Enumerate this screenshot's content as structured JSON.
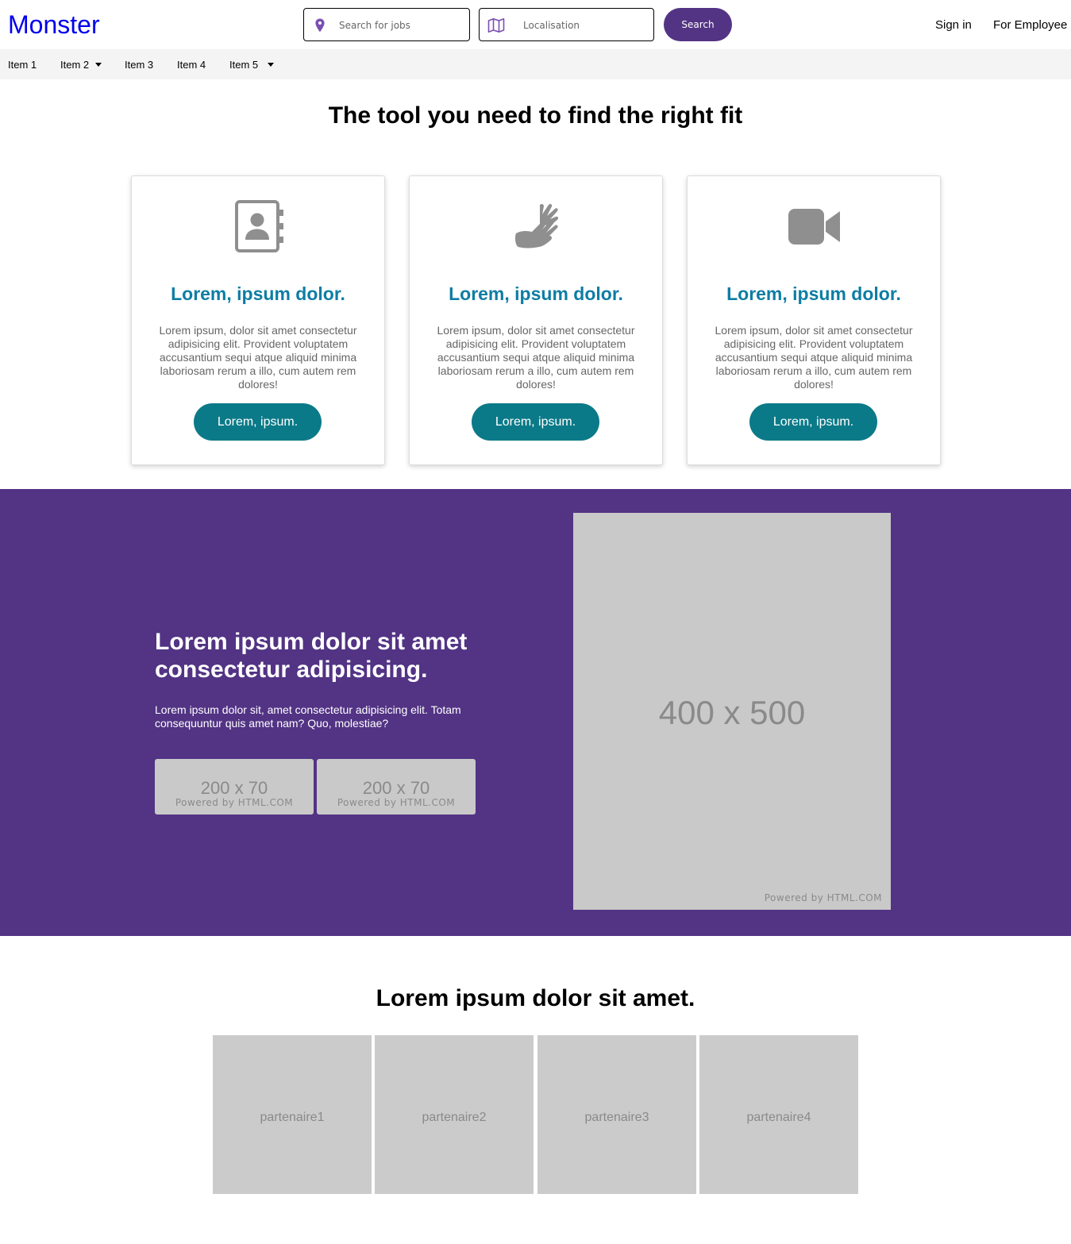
{
  "header": {
    "logo": "Monster",
    "search_jobs_placeholder": "Search for jobs",
    "location_placeholder": "Localisation",
    "search_button": "Search",
    "sign_in": "Sign in",
    "for_employee": "For Employee"
  },
  "nav": {
    "items": [
      {
        "label": "Item 1",
        "dropdown": false
      },
      {
        "label": "Item 2",
        "dropdown": true
      },
      {
        "label": "Item 3",
        "dropdown": false
      },
      {
        "label": "Item 4",
        "dropdown": false
      },
      {
        "label": "Item 5",
        "dropdown": true
      }
    ]
  },
  "tools": {
    "title": "The tool you need to find the right fit",
    "cards": [
      {
        "icon": "address-book-icon",
        "title": "Lorem, ipsum dolor.",
        "text": "Lorem ipsum, dolor sit amet consectetur adipisicing elit. Provident voluptatem accusantium sequi atque aliquid minima laboriosam rerum a illo, cum autem rem dolores!",
        "button": "Lorem, ipsum."
      },
      {
        "icon": "sign-language-hands-icon",
        "title": "Lorem, ipsum dolor.",
        "text": "Lorem ipsum, dolor sit amet consectetur adipisicing elit. Provident voluptatem accusantium sequi atque aliquid minima laboriosam rerum a illo, cum autem rem dolores!",
        "button": "Lorem, ipsum."
      },
      {
        "icon": "video-camera-icon",
        "title": "Lorem, ipsum dolor.",
        "text": "Lorem ipsum, dolor sit amet consectetur adipisicing elit. Provident voluptatem accusantium sequi atque aliquid minima laboriosam rerum a illo, cum autem rem dolores!",
        "button": "Lorem, ipsum."
      }
    ]
  },
  "promo": {
    "heading": "Lorem ipsum dolor sit amet consectetur adipisicing.",
    "text": "Lorem ipsum dolor sit, amet consectetur adipisicing elit. Totam consequuntur quis amet nam? Quo, molestiae?",
    "buttons": [
      {
        "size": "200 x 70",
        "powered": "Powered by HTML.COM"
      },
      {
        "size": "200 x 70",
        "powered": "Powered by HTML.COM"
      }
    ],
    "image": {
      "size": "400 x 500",
      "powered": "Powered by HTML.COM"
    }
  },
  "partners": {
    "title": "Lorem ipsum dolor sit amet.",
    "items": [
      "partenaire1",
      "partenaire2",
      "partenaire3",
      "partenaire4"
    ]
  },
  "colors": {
    "brand_purple": "#523384",
    "card_title": "#0e7da4",
    "card_button": "#0b7a88",
    "logo_blue": "#0000ee",
    "placeholder_gray": "#c9c9c9"
  }
}
